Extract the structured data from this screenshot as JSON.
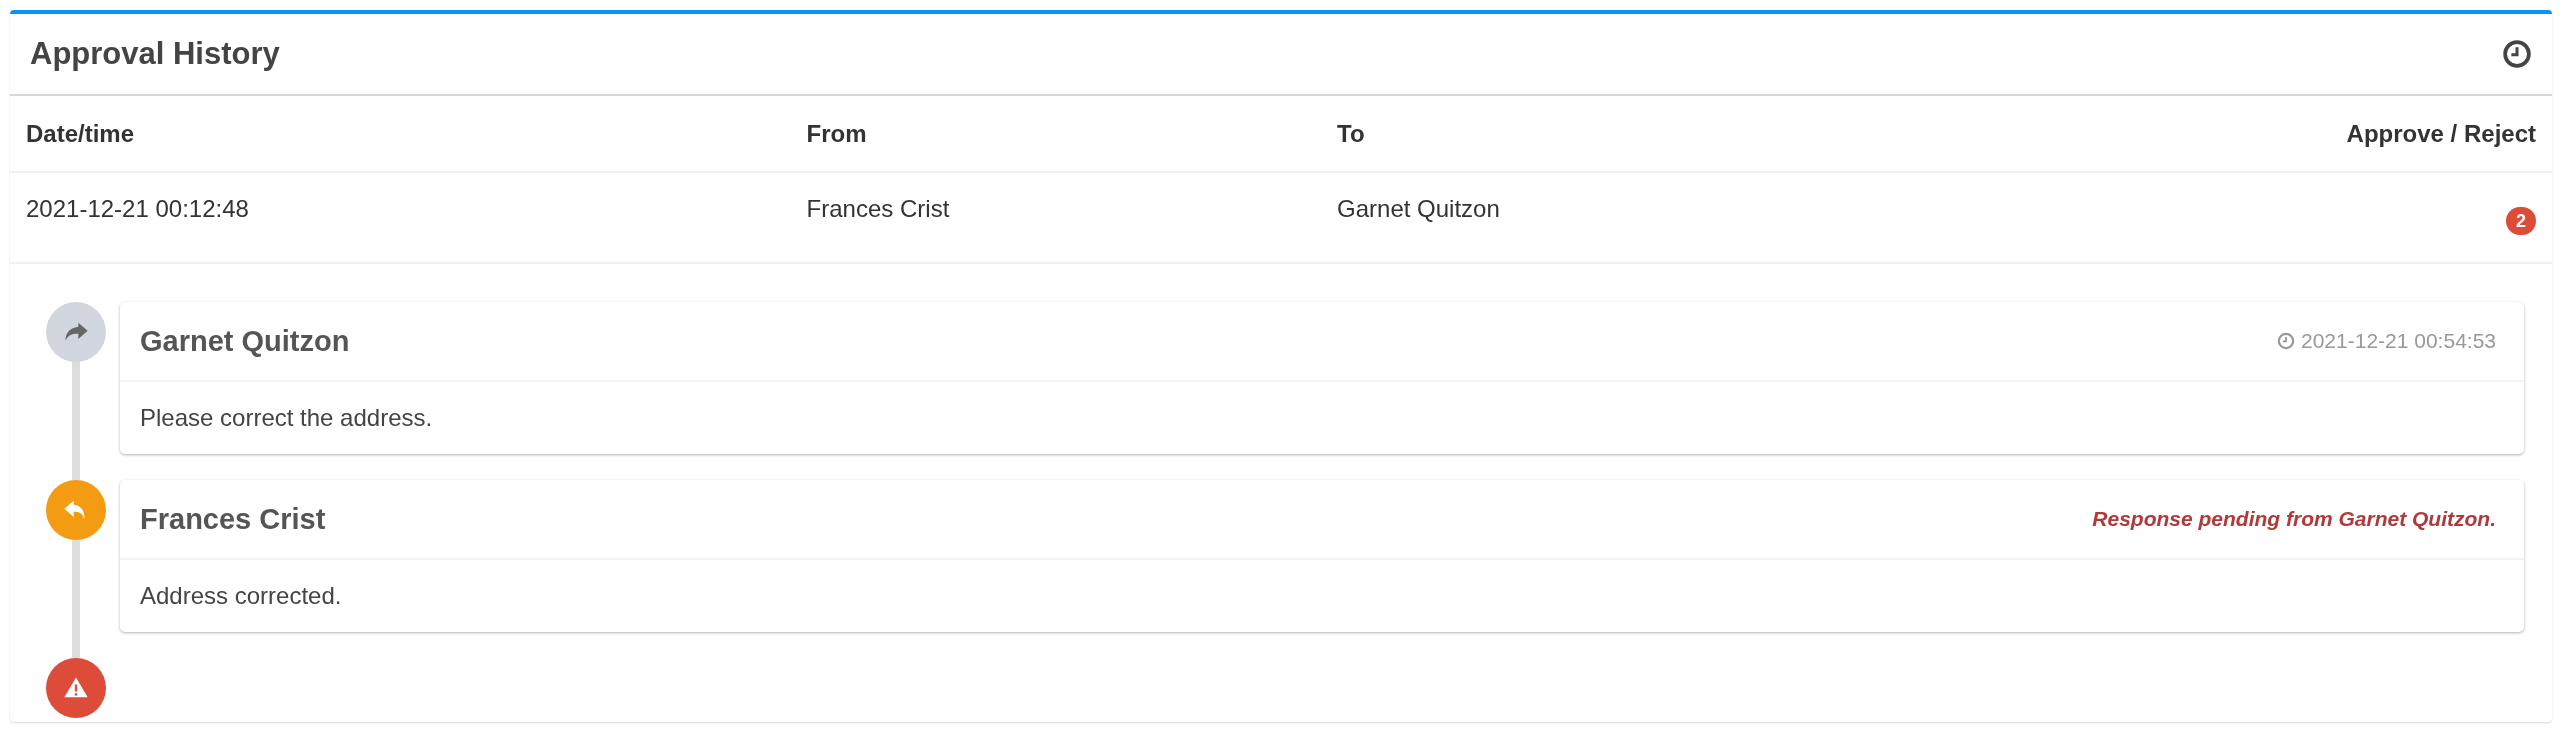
{
  "panel": {
    "title": "Approval History"
  },
  "table": {
    "columns": [
      "Date/time",
      "From",
      "To",
      "Approve / Reject"
    ],
    "rows": [
      {
        "datetime": "2021-12-21 00:12:48",
        "from": "Frances Crist",
        "to": "Garnet Quitzon",
        "badge": "2"
      }
    ]
  },
  "timeline": [
    {
      "kind": "forward",
      "name": "Garnet Quitzon",
      "timestamp": "2021-12-21 00:54:53",
      "body": "Please correct the address."
    },
    {
      "kind": "reply",
      "name": "Frances Crist",
      "pending_note": "Response pending from Garnet Quitzon.",
      "body": "Address corrected."
    },
    {
      "kind": "alert"
    }
  ]
}
